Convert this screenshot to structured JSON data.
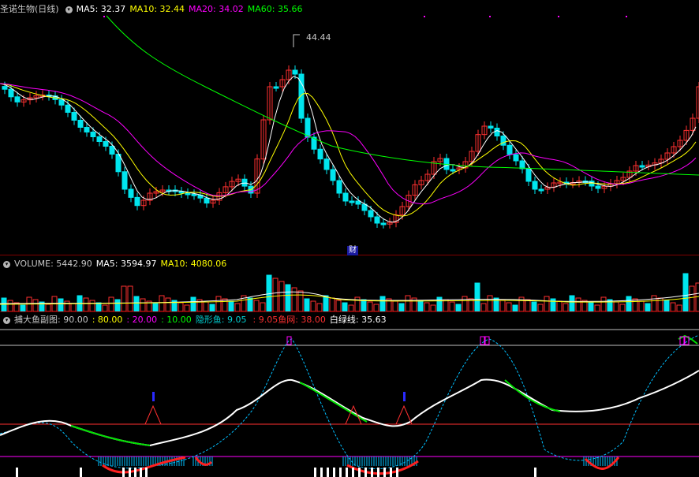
{
  "main_panel": {
    "stock_title": "圣诺生物(日线)",
    "ma5": "MA5: 32.37",
    "ma10": "MA10: 32.44",
    "ma20": "MA20: 34.02",
    "ma60": "MA60: 35.66",
    "peak_label": "44.44",
    "finance_marker": "财"
  },
  "volume_panel": {
    "title": "VOLUME: 5442.90",
    "ma5": "MA5: 3594.97",
    "ma10": "MA10: 4080.06"
  },
  "indicator_panel": {
    "title": "捕大鱼副图",
    "level_90": ": 90.00",
    "level_80": ": 80.00",
    "level_20": ": 20.00",
    "level_10": ": 10.00",
    "hidden_fish": "隐形鱼: 9.05",
    "value_905": ": 9.05",
    "fish_net": "鱼网: 38.00",
    "white_green_line": "白绿线: 35.63"
  },
  "colors": {
    "up": "#ff3030",
    "down": "#00e5ee",
    "ma5": "#ffffff",
    "ma10": "#ffff00",
    "ma20": "#ff00ff",
    "ma60": "#00ff00",
    "separator": "#800000"
  }
}
